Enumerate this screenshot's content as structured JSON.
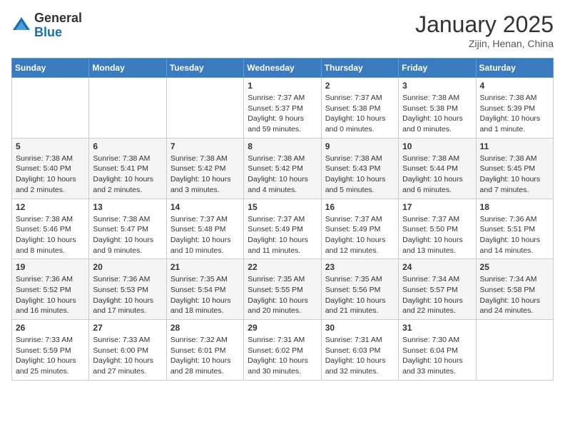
{
  "logo": {
    "general": "General",
    "blue": "Blue"
  },
  "title": "January 2025",
  "subtitle": "Zijin, Henan, China",
  "days_header": [
    "Sunday",
    "Monday",
    "Tuesday",
    "Wednesday",
    "Thursday",
    "Friday",
    "Saturday"
  ],
  "weeks": [
    [
      {
        "day": "",
        "info": ""
      },
      {
        "day": "",
        "info": ""
      },
      {
        "day": "",
        "info": ""
      },
      {
        "day": "1",
        "info": "Sunrise: 7:37 AM\nSunset: 5:37 PM\nDaylight: 9 hours and 59 minutes."
      },
      {
        "day": "2",
        "info": "Sunrise: 7:37 AM\nSunset: 5:38 PM\nDaylight: 10 hours and 0 minutes."
      },
      {
        "day": "3",
        "info": "Sunrise: 7:38 AM\nSunset: 5:38 PM\nDaylight: 10 hours and 0 minutes."
      },
      {
        "day": "4",
        "info": "Sunrise: 7:38 AM\nSunset: 5:39 PM\nDaylight: 10 hours and 1 minute."
      }
    ],
    [
      {
        "day": "5",
        "info": "Sunrise: 7:38 AM\nSunset: 5:40 PM\nDaylight: 10 hours and 2 minutes."
      },
      {
        "day": "6",
        "info": "Sunrise: 7:38 AM\nSunset: 5:41 PM\nDaylight: 10 hours and 2 minutes."
      },
      {
        "day": "7",
        "info": "Sunrise: 7:38 AM\nSunset: 5:42 PM\nDaylight: 10 hours and 3 minutes."
      },
      {
        "day": "8",
        "info": "Sunrise: 7:38 AM\nSunset: 5:42 PM\nDaylight: 10 hours and 4 minutes."
      },
      {
        "day": "9",
        "info": "Sunrise: 7:38 AM\nSunset: 5:43 PM\nDaylight: 10 hours and 5 minutes."
      },
      {
        "day": "10",
        "info": "Sunrise: 7:38 AM\nSunset: 5:44 PM\nDaylight: 10 hours and 6 minutes."
      },
      {
        "day": "11",
        "info": "Sunrise: 7:38 AM\nSunset: 5:45 PM\nDaylight: 10 hours and 7 minutes."
      }
    ],
    [
      {
        "day": "12",
        "info": "Sunrise: 7:38 AM\nSunset: 5:46 PM\nDaylight: 10 hours and 8 minutes."
      },
      {
        "day": "13",
        "info": "Sunrise: 7:38 AM\nSunset: 5:47 PM\nDaylight: 10 hours and 9 minutes."
      },
      {
        "day": "14",
        "info": "Sunrise: 7:37 AM\nSunset: 5:48 PM\nDaylight: 10 hours and 10 minutes."
      },
      {
        "day": "15",
        "info": "Sunrise: 7:37 AM\nSunset: 5:49 PM\nDaylight: 10 hours and 11 minutes."
      },
      {
        "day": "16",
        "info": "Sunrise: 7:37 AM\nSunset: 5:49 PM\nDaylight: 10 hours and 12 minutes."
      },
      {
        "day": "17",
        "info": "Sunrise: 7:37 AM\nSunset: 5:50 PM\nDaylight: 10 hours and 13 minutes."
      },
      {
        "day": "18",
        "info": "Sunrise: 7:36 AM\nSunset: 5:51 PM\nDaylight: 10 hours and 14 minutes."
      }
    ],
    [
      {
        "day": "19",
        "info": "Sunrise: 7:36 AM\nSunset: 5:52 PM\nDaylight: 10 hours and 16 minutes."
      },
      {
        "day": "20",
        "info": "Sunrise: 7:36 AM\nSunset: 5:53 PM\nDaylight: 10 hours and 17 minutes."
      },
      {
        "day": "21",
        "info": "Sunrise: 7:35 AM\nSunset: 5:54 PM\nDaylight: 10 hours and 18 minutes."
      },
      {
        "day": "22",
        "info": "Sunrise: 7:35 AM\nSunset: 5:55 PM\nDaylight: 10 hours and 20 minutes."
      },
      {
        "day": "23",
        "info": "Sunrise: 7:35 AM\nSunset: 5:56 PM\nDaylight: 10 hours and 21 minutes."
      },
      {
        "day": "24",
        "info": "Sunrise: 7:34 AM\nSunset: 5:57 PM\nDaylight: 10 hours and 22 minutes."
      },
      {
        "day": "25",
        "info": "Sunrise: 7:34 AM\nSunset: 5:58 PM\nDaylight: 10 hours and 24 minutes."
      }
    ],
    [
      {
        "day": "26",
        "info": "Sunrise: 7:33 AM\nSunset: 5:59 PM\nDaylight: 10 hours and 25 minutes."
      },
      {
        "day": "27",
        "info": "Sunrise: 7:33 AM\nSunset: 6:00 PM\nDaylight: 10 hours and 27 minutes."
      },
      {
        "day": "28",
        "info": "Sunrise: 7:32 AM\nSunset: 6:01 PM\nDaylight: 10 hours and 28 minutes."
      },
      {
        "day": "29",
        "info": "Sunrise: 7:31 AM\nSunset: 6:02 PM\nDaylight: 10 hours and 30 minutes."
      },
      {
        "day": "30",
        "info": "Sunrise: 7:31 AM\nSunset: 6:03 PM\nDaylight: 10 hours and 32 minutes."
      },
      {
        "day": "31",
        "info": "Sunrise: 7:30 AM\nSunset: 6:04 PM\nDaylight: 10 hours and 33 minutes."
      },
      {
        "day": "",
        "info": ""
      }
    ]
  ]
}
